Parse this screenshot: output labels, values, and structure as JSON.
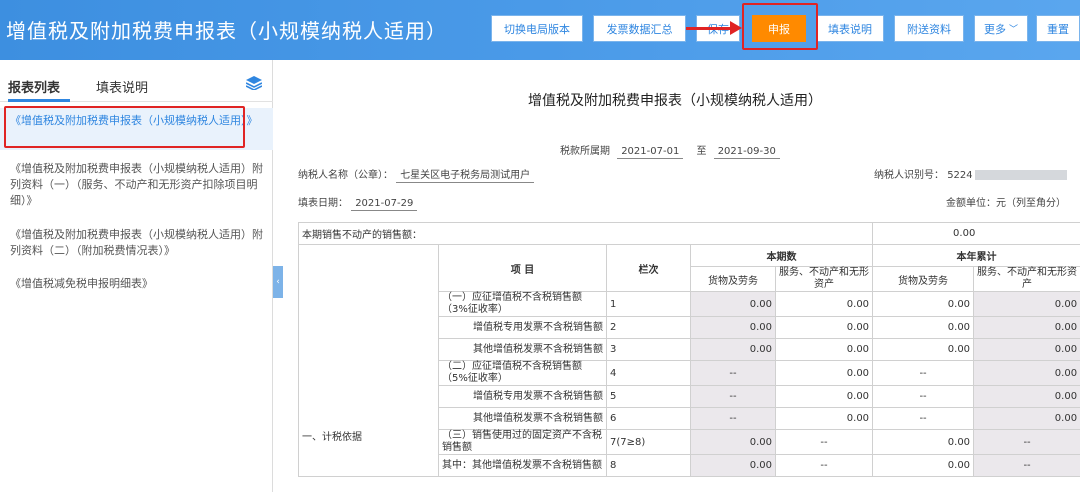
{
  "header": {
    "title": "增值税及附加税费申报表（小规模纳税人适用）",
    "buttons": {
      "switch_version": "切换电局版本",
      "invoice_summary": "发票数据汇总",
      "save": "保存",
      "declare": "申报",
      "fill_instructions": "填表说明",
      "attachments": "附送资料",
      "more": "更多",
      "reset": "重置"
    }
  },
  "sidebar": {
    "tabs": [
      "报表列表",
      "填表说明"
    ],
    "items": [
      "《增值税及附加税费申报表（小规模纳税人适用）》",
      "《增值税及附加税费申报表（小规模纳税人适用）附列资料（一）（服务、不动产和无形资产扣除项目明细）》",
      "《增值税及附加税费申报表（小规模纳税人适用）附列资料（二）（附加税费情况表）》",
      "《增值税减免税申报明细表》"
    ]
  },
  "form": {
    "title": "增值税及附加税费申报表（小规模纳税人适用）",
    "period_label": "税款所属期",
    "period_start": "2021-07-01",
    "period_to": "至",
    "period_end": "2021-09-30",
    "taxpayer_name_label": "纳税人名称（公章）：",
    "taxpayer_name": "七星关区电子税务局测试用户",
    "taxpayer_id_label": "纳税人识别号：",
    "taxpayer_id_prefix": "5224",
    "fill_date_label": "填表日期：",
    "fill_date": "2021-07-29",
    "unit_note": "金额单位：元（列至角分）"
  },
  "table": {
    "real_estate_label": "本期销售不动产的销售额：",
    "real_estate_value": "0.00",
    "item_header": "项  目",
    "col_header": "栏次",
    "current_period": "本期数",
    "year_total": "本年累计",
    "goods": "货物及劳务",
    "services": "服务、不动产和无形资产",
    "section_label": "一、计税依据",
    "rows": [
      {
        "item": "（一）应征增值税不含税销售额（3%征收率）",
        "col": "1",
        "v1": "0.00",
        "v2": "0.00",
        "v3": "0.00",
        "v4": "0.00"
      },
      {
        "item": "增值税专用发票不含税销售额",
        "col": "2",
        "v1": "0.00",
        "v2": "0.00",
        "v3": "0.00",
        "v4": "0.00"
      },
      {
        "item": "其他增值税发票不含税销售额",
        "col": "3",
        "v1": "0.00",
        "v2": "0.00",
        "v3": "0.00",
        "v4": "0.00"
      },
      {
        "item": "（二）应征增值税不含税销售额（5%征收率）",
        "col": "4",
        "v1": "--",
        "v2": "0.00",
        "v3": "--",
        "v4": "0.00"
      },
      {
        "item": "增值税专用发票不含税销售额",
        "col": "5",
        "v1": "--",
        "v2": "0.00",
        "v3": "--",
        "v4": "0.00"
      },
      {
        "item": "其他增值税发票不含税销售额",
        "col": "6",
        "v1": "--",
        "v2": "0.00",
        "v3": "--",
        "v4": "0.00"
      },
      {
        "item": "（三）销售使用过的固定资产不含税销售额",
        "col": "7(7≥8)",
        "v1": "0.00",
        "v2": "--",
        "v3": "0.00",
        "v4": "--"
      },
      {
        "item": "其中：其他增值税发票不含税销售额",
        "col": "8",
        "v1": "0.00",
        "v2": "--",
        "v3": "0.00",
        "v4": "--"
      }
    ]
  }
}
